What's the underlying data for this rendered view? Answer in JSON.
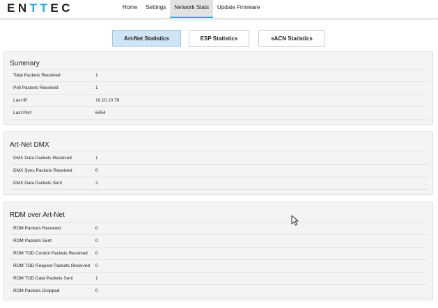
{
  "header": {
    "logo_text": {
      "a": "EN",
      "b": "TT",
      "c": "EC"
    },
    "nav": [
      {
        "label": "Home",
        "active": false
      },
      {
        "label": "Settings",
        "active": false
      },
      {
        "label": "Network Stats",
        "active": true
      },
      {
        "label": "Update Firmware",
        "active": false
      }
    ]
  },
  "tabs": [
    {
      "label": "Art-Net Statistics",
      "active": true
    },
    {
      "label": "ESP Statistics",
      "active": false
    },
    {
      "label": "sACN Statistics",
      "active": false
    }
  ],
  "sections": [
    {
      "title": "Summary",
      "rows": [
        {
          "label": "Total Packets Received",
          "value": "1"
        },
        {
          "label": "Poll Packets Received",
          "value": "1"
        },
        {
          "label": "Last IP",
          "value": "10.10.10.78"
        },
        {
          "label": "Last Port",
          "value": "6454"
        }
      ]
    },
    {
      "title": "Art-Net DMX",
      "rows": [
        {
          "label": "DMX Data Packets Received",
          "value": "1"
        },
        {
          "label": "DMX Sync Packets Received",
          "value": "0"
        },
        {
          "label": "DMX Data Packets Sent",
          "value": "2"
        }
      ]
    },
    {
      "title": "RDM over Art-Net",
      "rows": [
        {
          "label": "RDM Packets Received",
          "value": "0"
        },
        {
          "label": "RDM Packets Sent",
          "value": "0"
        },
        {
          "label": "RDM TOD Control Packets Received",
          "value": "0"
        },
        {
          "label": "RDM TOD Request Packets Received",
          "value": "0"
        },
        {
          "label": "RDM TOD Data Packets Sent",
          "value": "1"
        },
        {
          "label": "RDM Packets Dropped",
          "value": "0"
        }
      ]
    }
  ],
  "colors": {
    "accent": "#2aa7e0",
    "active_tab": "#cfe5f5",
    "panel": "#f4f4f4"
  },
  "icons": {
    "cursor": "mouse-pointer-icon"
  }
}
